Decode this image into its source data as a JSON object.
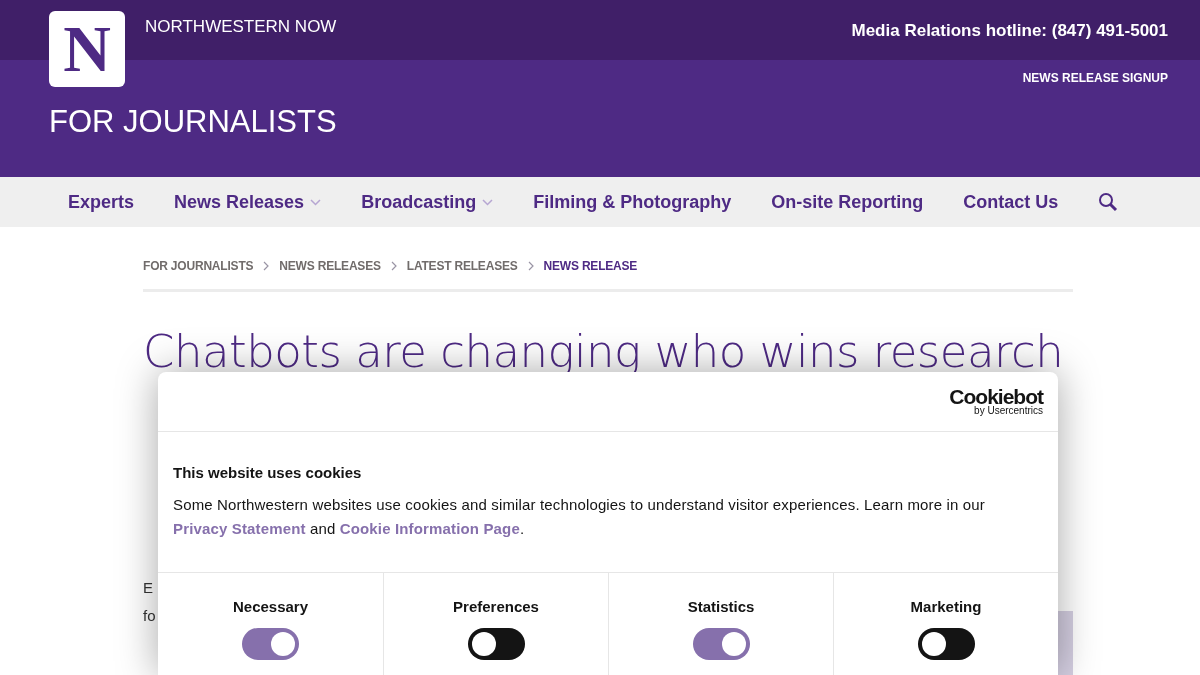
{
  "header": {
    "logo_letter": "N",
    "site_name": "NORTHWESTERN NOW",
    "hotline": "Media Relations hotline: (847) 491-5001",
    "signup_link": "NEWS RELEASE SIGNUP",
    "section_title": "FOR JOURNALISTS"
  },
  "nav": {
    "items": [
      {
        "label": "Experts",
        "has_dropdown": false
      },
      {
        "label": "News Releases",
        "has_dropdown": true
      },
      {
        "label": "Broadcasting",
        "has_dropdown": true
      },
      {
        "label": "Filming & Photography",
        "has_dropdown": false
      },
      {
        "label": "On-site Reporting",
        "has_dropdown": false
      },
      {
        "label": "Contact Us",
        "has_dropdown": false
      }
    ]
  },
  "breadcrumb": [
    {
      "label": "FOR JOURNALISTS",
      "current": false
    },
    {
      "label": "NEWS RELEASES",
      "current": false
    },
    {
      "label": "LATEST RELEASES",
      "current": false
    },
    {
      "label": "NEWS RELEASE",
      "current": true
    }
  ],
  "article": {
    "title_lines": [
      "Chatbots are changing who wins research"
    ],
    "body_fragments": [
      "E",
      "fo"
    ]
  },
  "cookie_dialog": {
    "brand": "Cookiebot",
    "brand_sub": "by Usercentrics",
    "heading": "This website uses cookies",
    "text": [
      {
        "kind": "text",
        "text": "Some Northwestern websites use cookies and similar technologies to understand visitor experiences. Learn more in our "
      },
      {
        "kind": "link",
        "text": "Privacy Statement"
      },
      {
        "kind": "text",
        "text": " and "
      },
      {
        "kind": "link",
        "text": "Cookie Information Page"
      },
      {
        "kind": "text",
        "text": "."
      }
    ],
    "categories": [
      {
        "label": "Necessary",
        "on": true
      },
      {
        "label": "Preferences",
        "on": false
      },
      {
        "label": "Statistics",
        "on": true
      },
      {
        "label": "Marketing",
        "on": false
      }
    ]
  }
}
